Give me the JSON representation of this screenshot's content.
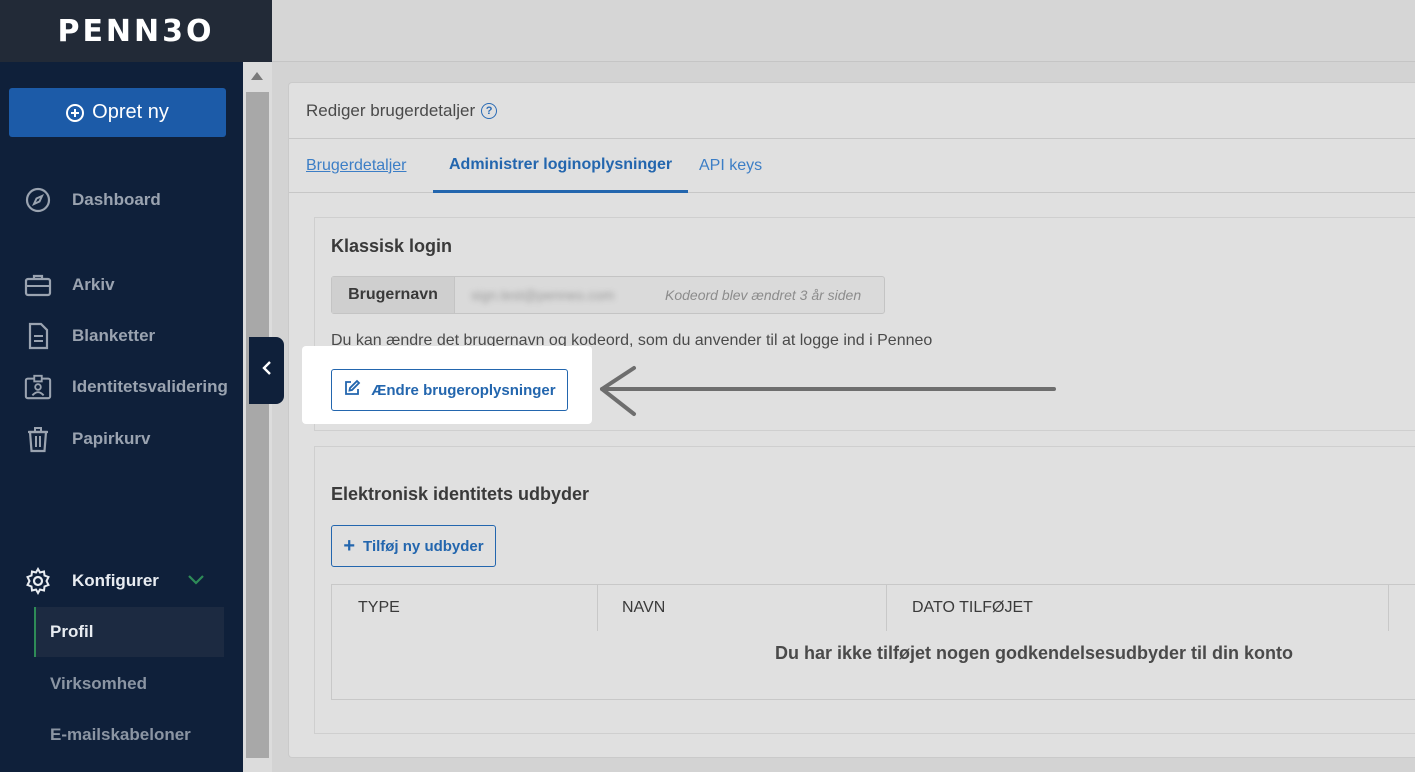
{
  "sidebar": {
    "logo": "PENN3O",
    "create_button": "Opret ny",
    "items": [
      {
        "label": "Dashboard",
        "icon": "compass-icon"
      },
      {
        "label": "Arkiv",
        "icon": "briefcase-icon"
      },
      {
        "label": "Blanketter",
        "icon": "document-icon"
      },
      {
        "label": "Identitetsvalidering",
        "icon": "id-card-icon"
      },
      {
        "label": "Papirkurv",
        "icon": "trash-icon"
      }
    ],
    "config": {
      "label": "Konfigurer",
      "icon": "gear-icon"
    },
    "sub_items": [
      "Profil",
      "Virksomhed",
      "E-mailskabeloner"
    ]
  },
  "page": {
    "title": "Rediger brugerdetaljer",
    "tabs": [
      "Brugerdetaljer",
      "Administrer loginoplysninger",
      "API keys"
    ]
  },
  "classic_login": {
    "title": "Klassisk login",
    "username_label": "Brugernavn",
    "username_value": "sign.test@penneo.com",
    "password_note": "Kodeord blev ændret 3 år siden",
    "description": "Du kan ændre det brugernavn og kodeord, som du anvender til at logge ind i Penneo",
    "edit_button": "Ændre brugeroplysninger"
  },
  "eid": {
    "title": "Elektronisk identitets udbyder",
    "add_button": "Tilføj ny udbyder",
    "columns": [
      "TYPE",
      "NAVN",
      "DATO TILFØJET"
    ],
    "empty_message": "Du har ikke tilføjet nogen godkendelsesudbyder til din konto"
  },
  "colors": {
    "sidebar_bg": "#0f203a",
    "accent": "#2366ae",
    "create_button": "#1c5ba8"
  }
}
